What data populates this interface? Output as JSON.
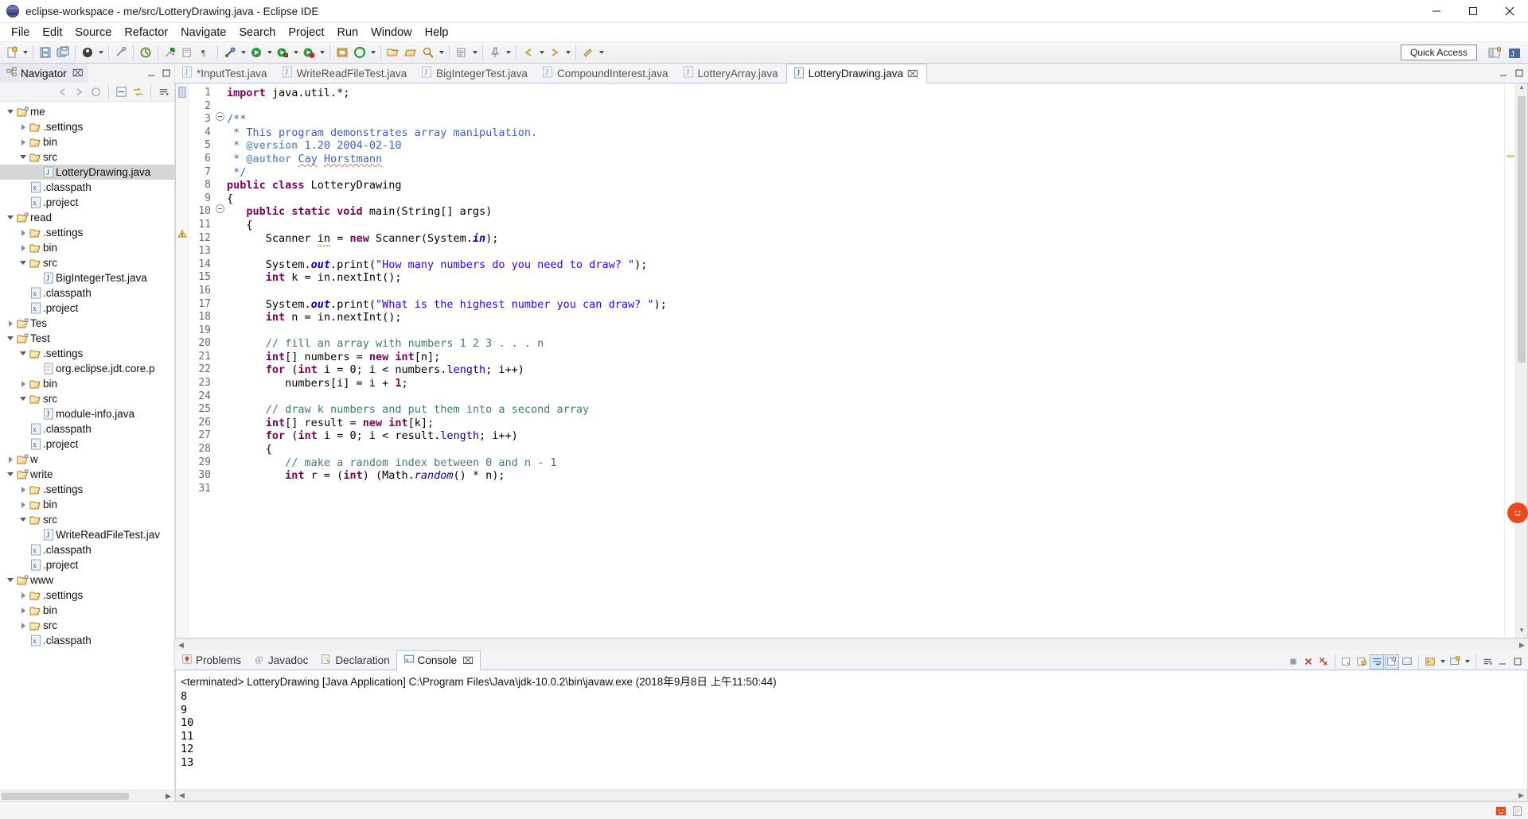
{
  "window": {
    "title": "eclipse-workspace - me/src/LotteryDrawing.java - Eclipse IDE",
    "app_icon": "eclipse-icon",
    "minimize": "—",
    "maximize": "❐",
    "close": "✕"
  },
  "menubar": {
    "items": [
      {
        "label": "File"
      },
      {
        "label": "Edit"
      },
      {
        "label": "Source"
      },
      {
        "label": "Refactor"
      },
      {
        "label": "Navigate"
      },
      {
        "label": "Search"
      },
      {
        "label": "Project"
      },
      {
        "label": "Run"
      },
      {
        "label": "Window"
      },
      {
        "label": "Help"
      }
    ]
  },
  "toolbar": {
    "quick_access": "Quick Access",
    "buttons": [
      {
        "name": "new-wizard",
        "icon": "new-file-icon"
      },
      {
        "name": "save",
        "icon": "save-icon"
      },
      {
        "name": "save-all",
        "icon": "save-all-icon"
      },
      {
        "name": "print",
        "icon": "print-icon"
      },
      {
        "name": "toggle-breadcrumb",
        "icon": "breadcrumb-icon"
      },
      {
        "name": "build-all",
        "icon": "build-icon"
      },
      {
        "name": "skip-breakpoints",
        "icon": "skip-breakpoints-icon"
      },
      {
        "name": "debug",
        "icon": "debug-icon"
      },
      {
        "name": "run",
        "icon": "run-icon"
      },
      {
        "name": "run-coverage",
        "icon": "coverage-icon"
      },
      {
        "name": "external-tools",
        "icon": "external-tools-icon"
      },
      {
        "name": "new-java-project",
        "icon": "java-project-icon"
      },
      {
        "name": "new-class",
        "icon": "new-class-icon"
      },
      {
        "name": "open-type",
        "icon": "open-type-icon"
      },
      {
        "name": "open-task",
        "icon": "task-icon"
      },
      {
        "name": "search",
        "icon": "search-icon"
      },
      {
        "name": "next-annotation",
        "icon": "next-annotation-icon"
      },
      {
        "name": "previous-annotation",
        "icon": "prev-annotation-icon"
      },
      {
        "name": "last-edit-location",
        "icon": "last-edit-icon"
      },
      {
        "name": "back",
        "icon": "back-arrow-icon"
      },
      {
        "name": "forward",
        "icon": "forward-arrow-icon"
      },
      {
        "name": "pin-editor",
        "icon": "pin-icon"
      }
    ]
  },
  "navigator": {
    "tab_label": "Navigator",
    "tab_icon": "navigator-icon",
    "close_glyph": "⌧",
    "view_menu_glyph": "▽",
    "minimize_glyph": "—",
    "maximize_glyph": "❐",
    "toolbar_icons": [
      "back-arrow-icon",
      "forward-arrow-icon",
      "home-icon",
      "collapse-all-icon",
      "link-with-editor-icon",
      "view-menu-icon"
    ],
    "tree": [
      {
        "depth": 0,
        "state": "open",
        "icon": "project-icon",
        "label": "me",
        "selected": false
      },
      {
        "depth": 1,
        "state": "closed",
        "icon": "folder-icon",
        "label": ".settings",
        "selected": false
      },
      {
        "depth": 1,
        "state": "closed",
        "icon": "folder-icon",
        "label": "bin",
        "selected": false
      },
      {
        "depth": 1,
        "state": "open",
        "icon": "folder-icon",
        "label": "src",
        "selected": false
      },
      {
        "depth": 2,
        "state": "none",
        "icon": "java-file-icon",
        "label": "LotteryDrawing.java",
        "selected": true
      },
      {
        "depth": 1,
        "state": "none",
        "icon": "xml-file-icon",
        "label": ".classpath",
        "selected": false
      },
      {
        "depth": 1,
        "state": "none",
        "icon": "xml-file-icon",
        "label": ".project",
        "selected": false
      },
      {
        "depth": 0,
        "state": "open",
        "icon": "project-icon",
        "label": "read",
        "selected": false
      },
      {
        "depth": 1,
        "state": "closed",
        "icon": "folder-icon",
        "label": ".settings",
        "selected": false
      },
      {
        "depth": 1,
        "state": "closed",
        "icon": "folder-icon",
        "label": "bin",
        "selected": false
      },
      {
        "depth": 1,
        "state": "open",
        "icon": "folder-icon",
        "label": "src",
        "selected": false
      },
      {
        "depth": 2,
        "state": "none",
        "icon": "java-file-icon",
        "label": "BigIntegerTest.java",
        "selected": false
      },
      {
        "depth": 1,
        "state": "none",
        "icon": "xml-file-icon",
        "label": ".classpath",
        "selected": false
      },
      {
        "depth": 1,
        "state": "none",
        "icon": "xml-file-icon",
        "label": ".project",
        "selected": false
      },
      {
        "depth": 0,
        "state": "closed",
        "icon": "project-icon",
        "label": "Tes",
        "selected": false
      },
      {
        "depth": 0,
        "state": "open",
        "icon": "project-icon",
        "label": "Test",
        "selected": false
      },
      {
        "depth": 1,
        "state": "open",
        "icon": "folder-icon",
        "label": ".settings",
        "selected": false
      },
      {
        "depth": 2,
        "state": "none",
        "icon": "text-file-icon",
        "label": "org.eclipse.jdt.core.p",
        "selected": false
      },
      {
        "depth": 1,
        "state": "closed",
        "icon": "folder-icon",
        "label": "bin",
        "selected": false
      },
      {
        "depth": 1,
        "state": "open",
        "icon": "folder-icon",
        "label": "src",
        "selected": false
      },
      {
        "depth": 2,
        "state": "none",
        "icon": "java-file-icon",
        "label": "module-info.java",
        "selected": false
      },
      {
        "depth": 1,
        "state": "none",
        "icon": "xml-file-icon",
        "label": ".classpath",
        "selected": false
      },
      {
        "depth": 1,
        "state": "none",
        "icon": "xml-file-icon",
        "label": ".project",
        "selected": false
      },
      {
        "depth": 0,
        "state": "closed",
        "icon": "project-icon",
        "label": "w",
        "selected": false
      },
      {
        "depth": 0,
        "state": "open",
        "icon": "project-icon",
        "label": "write",
        "selected": false
      },
      {
        "depth": 1,
        "state": "closed",
        "icon": "folder-icon",
        "label": ".settings",
        "selected": false
      },
      {
        "depth": 1,
        "state": "closed",
        "icon": "folder-icon",
        "label": "bin",
        "selected": false
      },
      {
        "depth": 1,
        "state": "open",
        "icon": "folder-icon",
        "label": "src",
        "selected": false
      },
      {
        "depth": 2,
        "state": "none",
        "icon": "java-file-icon",
        "label": "WriteReadFileTest.jav",
        "selected": false
      },
      {
        "depth": 1,
        "state": "none",
        "icon": "xml-file-icon",
        "label": ".classpath",
        "selected": false
      },
      {
        "depth": 1,
        "state": "none",
        "icon": "xml-file-icon",
        "label": ".project",
        "selected": false
      },
      {
        "depth": 0,
        "state": "open",
        "icon": "project-icon",
        "label": "www",
        "selected": false
      },
      {
        "depth": 1,
        "state": "closed",
        "icon": "folder-icon",
        "label": ".settings",
        "selected": false
      },
      {
        "depth": 1,
        "state": "closed",
        "icon": "folder-icon",
        "label": "bin",
        "selected": false
      },
      {
        "depth": 1,
        "state": "closed",
        "icon": "folder-icon",
        "label": "src",
        "selected": false
      },
      {
        "depth": 1,
        "state": "none",
        "icon": "xml-file-icon",
        "label": ".classpath",
        "selected": false
      }
    ]
  },
  "editor": {
    "minimize_glyph": "—",
    "maximize_glyph": "❐",
    "tabs": [
      {
        "label": "*InputTest.java",
        "icon": "java-file-icon",
        "active": false,
        "dirty": true
      },
      {
        "label": "WriteReadFileTest.java",
        "icon": "java-file-icon",
        "active": false,
        "dirty": false
      },
      {
        "label": "BigIntegerTest.java",
        "icon": "java-file-icon",
        "active": false,
        "dirty": false
      },
      {
        "label": "CompoundInterest.java",
        "icon": "java-file-icon",
        "active": false,
        "dirty": false
      },
      {
        "label": "LotteryArray.java",
        "icon": "java-file-icon",
        "active": false,
        "dirty": false
      },
      {
        "label": "LotteryDrawing.java",
        "icon": "java-file-icon",
        "active": true,
        "dirty": false
      }
    ],
    "first_line": 1,
    "lines": [
      {
        "n": 1,
        "fold": false,
        "html": "<span class=\"kw\">import</span> java.util.*;"
      },
      {
        "n": 2,
        "fold": false,
        "html": ""
      },
      {
        "n": 3,
        "fold": true,
        "html": "<span class=\"jdoc\">/**</span>"
      },
      {
        "n": 4,
        "fold": false,
        "html": "<span class=\"jdoc\"> * This program demonstrates array manipulation.</span>"
      },
      {
        "n": 5,
        "fold": false,
        "html": "<span class=\"jdoc\"> * </span><span class=\"jdoctag\">@version</span><span class=\"jdoc\"> 1.20 2004-02-10</span>"
      },
      {
        "n": 6,
        "fold": false,
        "html": "<span class=\"jdoc\"> * </span><span class=\"jdoctag\">@author</span><span class=\"jdoc\"> </span><span class=\"jdoc spell\">Cay</span><span class=\"jdoc\"> </span><span class=\"jdoc spell\">Horstmann</span>"
      },
      {
        "n": 7,
        "fold": false,
        "html": "<span class=\"jdoc\"> */</span>"
      },
      {
        "n": 8,
        "fold": false,
        "html": "<span class=\"kw\">public class</span> LotteryDrawing"
      },
      {
        "n": 9,
        "fold": false,
        "html": "{"
      },
      {
        "n": 10,
        "fold": true,
        "html": "   <span class=\"kw\">public static void</span> main(String[] args)"
      },
      {
        "n": 11,
        "fold": false,
        "html": "   {"
      },
      {
        "n": 12,
        "fold": false,
        "warn": true,
        "html": "      Scanner <span class=\"warnu\">in</span> = <span class=\"kw\">new</span> Scanner(System.<span class=\"fld\">in</span>);"
      },
      {
        "n": 13,
        "fold": false,
        "html": ""
      },
      {
        "n": 14,
        "fold": false,
        "html": "      System.<span class=\"fld\">out</span>.print(<span class=\"str\">\"How many numbers do you need to draw? \"</span>);"
      },
      {
        "n": 15,
        "fold": false,
        "html": "      <span class=\"kw\">int</span> k = in.nextInt();"
      },
      {
        "n": 16,
        "fold": false,
        "html": ""
      },
      {
        "n": 17,
        "fold": false,
        "html": "      System.<span class=\"fld\">out</span>.print(<span class=\"str\">\"What is the highest number you can draw? \"</span>);"
      },
      {
        "n": 18,
        "fold": false,
        "html": "      <span class=\"kw\">int</span> n = in.nextInt();"
      },
      {
        "n": 19,
        "fold": false,
        "html": ""
      },
      {
        "n": 20,
        "fold": false,
        "html": "      <span class=\"cmt\">// fill an array with numbers 1 2 3 . . . n</span>"
      },
      {
        "n": 21,
        "fold": false,
        "html": "      <span class=\"kw\">int</span>[] numbers = <span class=\"kw\">new</span> <span class=\"kw\">int</span>[n];"
      },
      {
        "n": 22,
        "fold": false,
        "html": "      <span class=\"kw\">for</span> (<span class=\"kw\">int</span> i = 0; i &lt; numbers.<span class=\"lenf\">length</span>; i++)"
      },
      {
        "n": 23,
        "fold": false,
        "html": "         numbers[i] = i + <span class=\"kw\">1</span>;"
      },
      {
        "n": 24,
        "fold": false,
        "html": ""
      },
      {
        "n": 25,
        "fold": false,
        "html": "      <span class=\"cmt\">// draw k numbers and put them into a second array</span>"
      },
      {
        "n": 26,
        "fold": false,
        "html": "      <span class=\"kw\">int</span>[] result = <span class=\"kw\">new</span> <span class=\"kw\">int</span>[k];"
      },
      {
        "n": 27,
        "fold": false,
        "html": "      <span class=\"kw\">for</span> (<span class=\"kw\">int</span> i = 0; i &lt; result.<span class=\"lenf\">length</span>; i++)"
      },
      {
        "n": 28,
        "fold": false,
        "html": "      {"
      },
      {
        "n": 29,
        "fold": false,
        "html": "         <span class=\"cmt\">// make a random index between 0 and n - 1</span>"
      },
      {
        "n": 30,
        "fold": false,
        "html": "         <span class=\"kw\">int</span> r = (<span class=\"kw\">int</span>) (Math.<span class=\"stat\">random</span>() * n);"
      },
      {
        "n": 31,
        "fold": false,
        "html": ""
      }
    ]
  },
  "console": {
    "tabs": [
      {
        "label": "Problems",
        "icon": "problems-icon",
        "active": false
      },
      {
        "label": "Javadoc",
        "icon": "javadoc-icon",
        "active": false
      },
      {
        "label": "Declaration",
        "icon": "declaration-icon",
        "active": false
      },
      {
        "label": "Console",
        "icon": "console-icon",
        "active": true
      }
    ],
    "close_glyph": "⌧",
    "toolbar_icons": [
      "terminate-icon",
      "remove-launch-icon",
      "remove-all-terminated-icon",
      "clear-console-icon",
      "scroll-lock-icon",
      "word-wrap-icon",
      "pin-console-icon",
      "display-console-icon",
      "open-console-icon",
      "new-console-view-icon",
      "view-menu-icon",
      "minimize-icon",
      "maximize-icon"
    ],
    "status_line": "<terminated> LotteryDrawing [Java Application] C:\\Program Files\\Java\\jdk-10.0.2\\bin\\javaw.exe (2018年9月8日 上午11:50:44)",
    "output": [
      "8",
      "9",
      "10",
      "11",
      "12",
      "13"
    ]
  },
  "statusbar": {
    "items": [
      "smiley-badge-icon",
      "writable-indicator-icon"
    ]
  },
  "colors": {
    "keyword": "#7f0055",
    "string": "#2a00ff",
    "comment": "#3f7f5f",
    "javadoc": "#3f5fbf",
    "javadoc_tag": "#7f9fbf",
    "field": "#0000c0",
    "selection": "#d6d6d6",
    "accent_badge": "#e8491d"
  }
}
